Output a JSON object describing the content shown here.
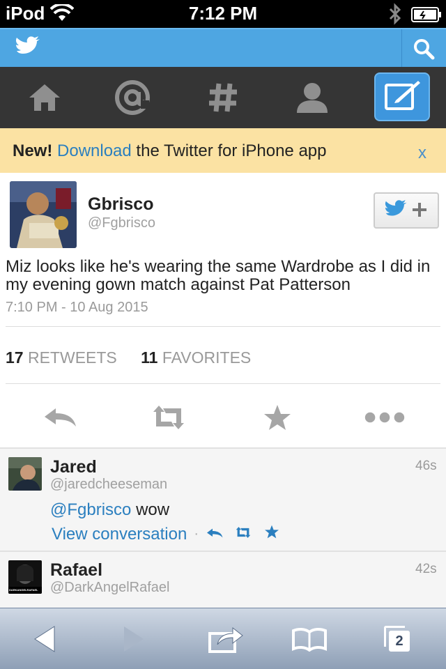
{
  "status_bar": {
    "carrier": "iPod",
    "time": "7:12 PM"
  },
  "header": {
    "brand_icon": "twitter-bird-icon",
    "search_icon": "search-icon"
  },
  "nav": {
    "items": [
      {
        "icon": "home-icon"
      },
      {
        "icon": "at-icon"
      },
      {
        "icon": "hashtag-icon"
      },
      {
        "icon": "profile-icon"
      },
      {
        "icon": "compose-icon",
        "active": true
      }
    ]
  },
  "promo": {
    "bold": "New!",
    "link": "Download",
    "rest": "the Twitter for iPhone app",
    "close": "x"
  },
  "tweet": {
    "name": "Gbrisco",
    "handle": "@Fgbrisco",
    "text": "Miz looks like he's wearing the same Wardrobe as I did in my evening gown match against Pat Patterson",
    "timestamp": "7:10 PM - 10 Aug 2015",
    "retweet_count": "17",
    "retweet_label": "RETWEETS",
    "favorite_count": "11",
    "favorite_label": "FAVORITES"
  },
  "replies": [
    {
      "name": "Jared",
      "handle": "@jaredcheeseman",
      "age": "46s",
      "mention": "@Fgbrisco",
      "text": "wow",
      "view_conversation": "View conversation"
    },
    {
      "name": "Rafael",
      "handle": "@DarkAngelRafael",
      "age": "42s",
      "avatar_text": "DARKANGELRAFAEL"
    }
  ],
  "safari_bar": {
    "tabs_count": "2"
  },
  "colors": {
    "twitter_blue": "#4ea6e2",
    "link": "#2b7fbf",
    "nav_dark": "#353535",
    "promo_bg": "#fbe2a3"
  }
}
